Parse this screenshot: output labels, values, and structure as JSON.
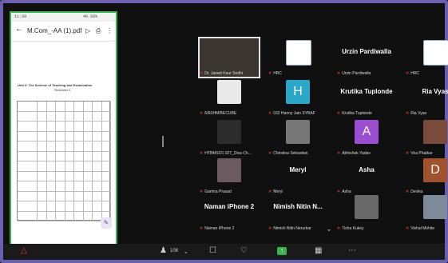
{
  "phone": {
    "status_time": "11:38",
    "status_right": "4G 68%",
    "doc_title": "M.Com_-AA (1).pdf",
    "doc_heading": "Unit 3: The Scheme of Teaching and Examination",
    "doc_subheading": "Semester II"
  },
  "tiles": [
    {
      "name": "Dr. Jaswit Kaur Sodhi"
    },
    {
      "name": "HRC"
    },
    {
      "big": "Urzin Pardiwalla",
      "name": "Urzin Pardiwalla"
    },
    {
      "name": "HRC"
    },
    {
      "name": "RASHMIBECUBE"
    },
    {
      "initial": "H",
      "name": "032 Hanny Jain SYBAF"
    },
    {
      "big": "Krutika Tuplonde",
      "name": "Krutika Tuplonde"
    },
    {
      "big": "Ria Vyas",
      "name": "Ria Vyas"
    },
    {
      "name": "HTBMSO1 027_Diva Ch..."
    },
    {
      "name": "Christina Sebastian"
    },
    {
      "initial": "A",
      "name": "Abhishek Yadav"
    },
    {
      "name": "Vira Phatkar"
    },
    {
      "name": "Garima Prasad"
    },
    {
      "big": "Meryl",
      "name": "Meryl"
    },
    {
      "big": "Asha",
      "name": "Asha"
    },
    {
      "initial": "D",
      "name": "Devika"
    },
    {
      "big": "Naman iPhone 2",
      "name": "Naman iPhone 2"
    },
    {
      "big": "Nimish Nitin N...",
      "name": "Nimish Nitin Nerurkar"
    },
    {
      "name": "Tisha Kukey"
    },
    {
      "name": "Vishal Mohite"
    }
  ],
  "controls": {
    "participants_count": "108",
    "mic_icon": "mic-muted-icon",
    "participants_icon": "people-icon",
    "more_icon": "more-icon"
  }
}
